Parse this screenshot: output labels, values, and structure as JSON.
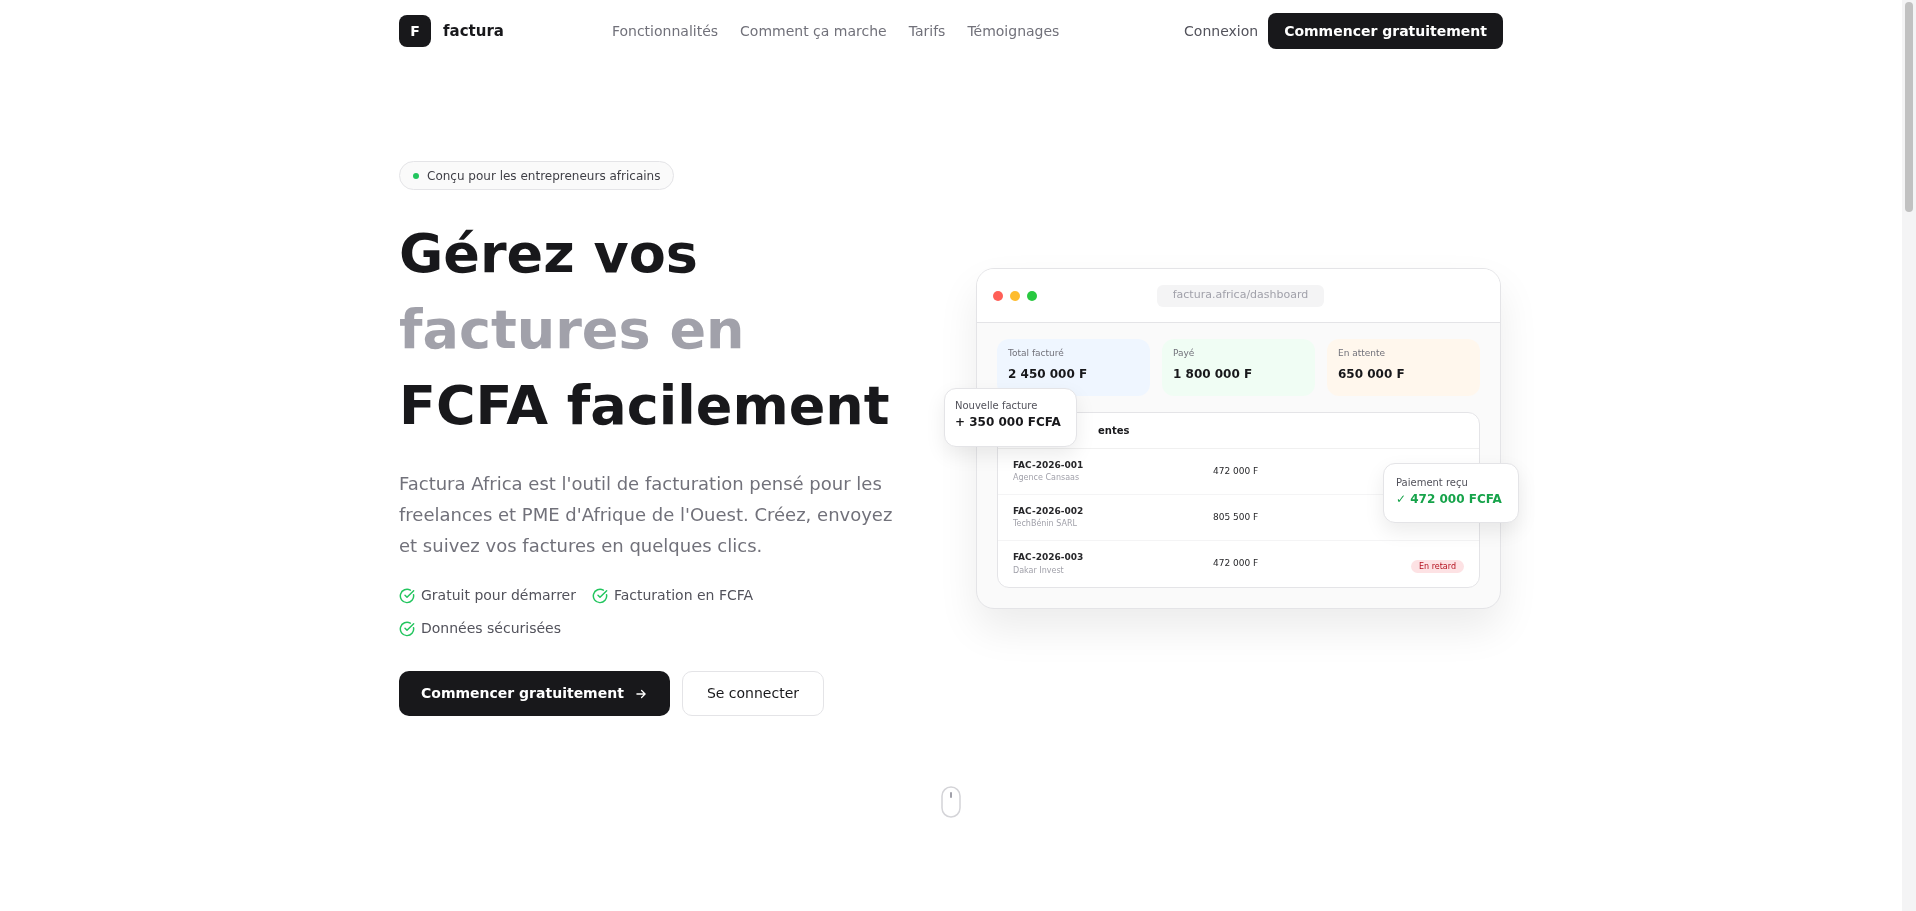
{
  "nav": {
    "logo_mark": "F",
    "logo_text": "factura",
    "links": [
      "Fonctionnalités",
      "Comment ça marche",
      "Tarifs",
      "Témoignages"
    ],
    "login": "Connexion",
    "cta": "Commencer gratuitement"
  },
  "hero": {
    "badge": "Conçu pour les entrepreneurs africains",
    "title_lines": [
      {
        "text": "Gérez vos",
        "muted": false
      },
      {
        "text": "factures en",
        "muted": true
      },
      {
        "text": "FCFA facilement",
        "muted": false
      }
    ],
    "description": "Factura Africa est l'outil de facturation pensé pour les freelances et PME d'Afrique de l'Ouest. Créez, envoyez et suivez vos factures en quelques clics.",
    "features": [
      "Gratuit pour démarrer",
      "Facturation en FCFA",
      "Données sécurisées"
    ],
    "primary_button": "Commencer gratuitement",
    "secondary_button": "Se connecter"
  },
  "mockup": {
    "window_dots": [
      {
        "color": "#ff5f57"
      },
      {
        "color": "#febc2e"
      },
      {
        "color": "#28c840"
      }
    ],
    "url": "factura.africa/dashboard",
    "stats": [
      {
        "label": "Total facturé",
        "value": "2 450 000 F",
        "color": "#eff6ff"
      },
      {
        "label": "Payé",
        "value": "1 800 000 F",
        "color": "#f0fdf4"
      },
      {
        "label": "En attente",
        "value": "650 000 F",
        "color": "#fff7ed"
      }
    ],
    "table_title": "entes",
    "rows": [
      {
        "number": "FAC-2026-001",
        "client": "Agence Cansaas",
        "amount": "472 000 F"
      },
      {
        "number": "FAC-2026-002",
        "client": "TechBénin SARL",
        "amount": "805 500 F"
      },
      {
        "number": "FAC-2026-003",
        "client": "Dakar Invest",
        "amount": "472 000 F",
        "status": {
          "kind": "late",
          "label": "En retard"
        }
      }
    ],
    "new_invoice": {
      "label": "Nouvelle facture",
      "value": "+ 350 000 FCFA"
    },
    "payment": {
      "label": "Paiement reçu",
      "value": "✓ 472 000 FCFA"
    }
  }
}
